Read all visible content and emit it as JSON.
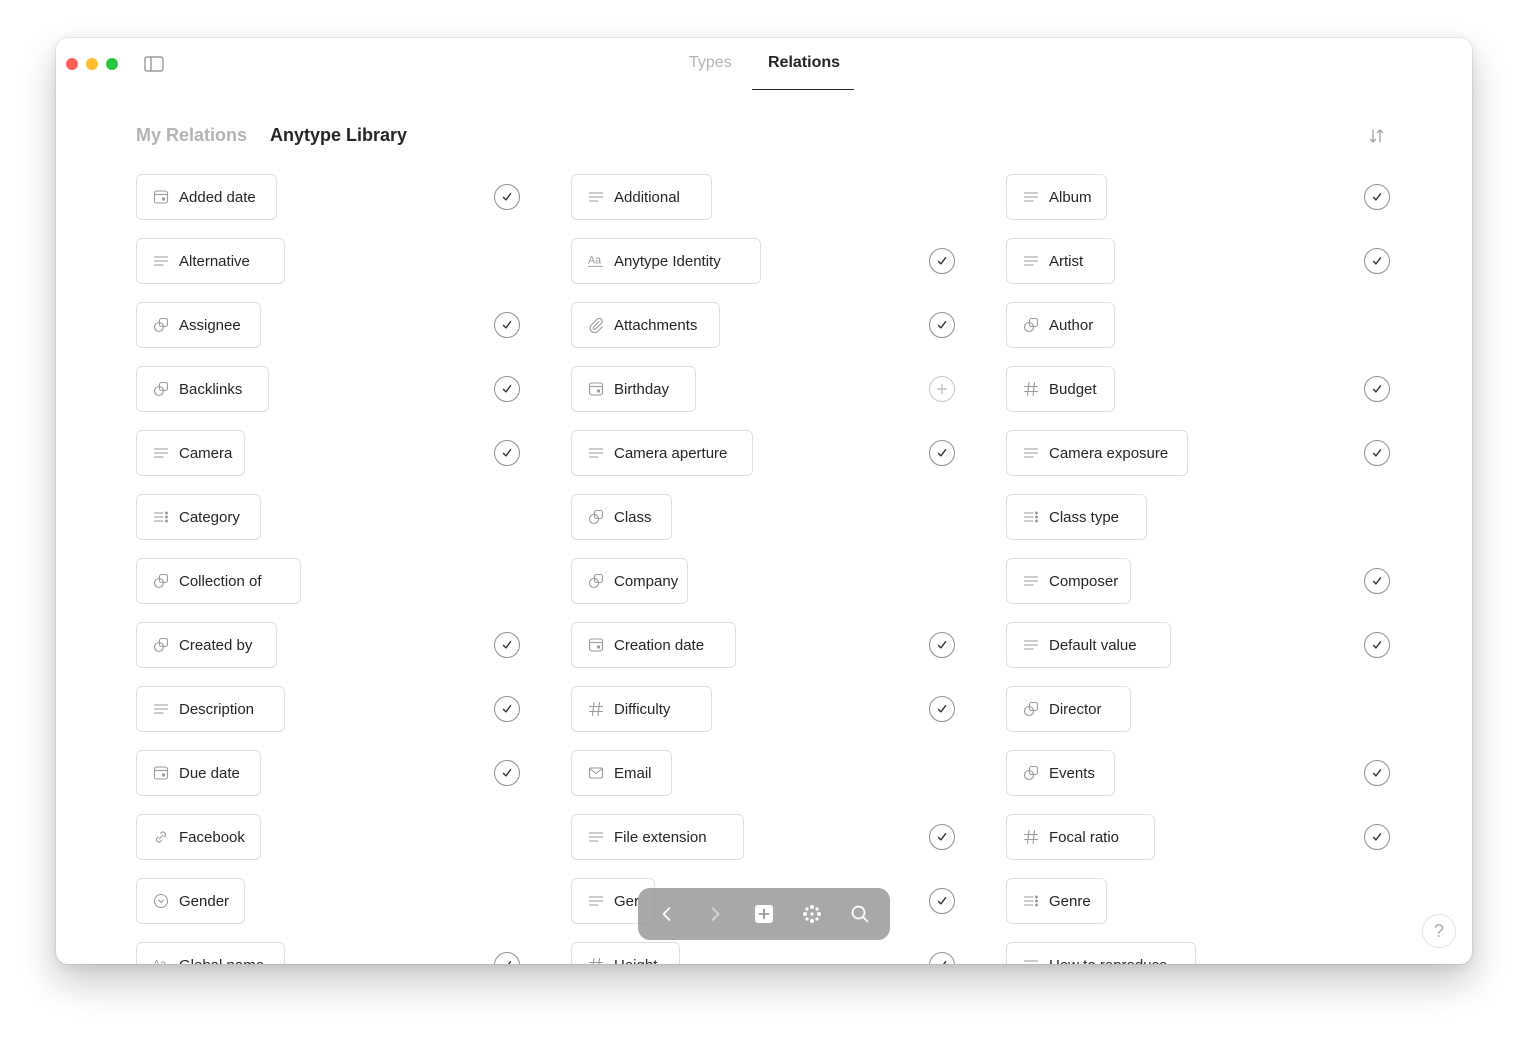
{
  "window": {
    "tabs": [
      {
        "label": "Types",
        "active": false
      },
      {
        "label": "Relations",
        "active": true
      }
    ]
  },
  "library": {
    "tabs": [
      {
        "label": "My Relations",
        "active": false
      },
      {
        "label": "Anytype Library",
        "active": true
      }
    ]
  },
  "relations": [
    {
      "label": "Added date",
      "icon": "calendar-icon",
      "status": "installed"
    },
    {
      "label": "Additional",
      "icon": "text-lines-icon",
      "status": "none"
    },
    {
      "label": "Album",
      "icon": "text-lines-icon",
      "status": "installed"
    },
    {
      "label": "Alternative",
      "icon": "text-lines-icon",
      "status": "none"
    },
    {
      "label": "Anytype Identity",
      "icon": "aa-text-icon",
      "status": "installed"
    },
    {
      "label": "Artist",
      "icon": "text-lines-icon",
      "status": "installed"
    },
    {
      "label": "Assignee",
      "icon": "object-icon",
      "status": "installed"
    },
    {
      "label": "Attachments",
      "icon": "paperclip-icon",
      "status": "installed"
    },
    {
      "label": "Author",
      "icon": "object-icon",
      "status": "none"
    },
    {
      "label": "Backlinks",
      "icon": "object-icon",
      "status": "installed"
    },
    {
      "label": "Birthday",
      "icon": "calendar-icon",
      "status": "add"
    },
    {
      "label": "Budget",
      "icon": "hash-icon",
      "status": "installed"
    },
    {
      "label": "Camera",
      "icon": "text-lines-icon",
      "status": "installed"
    },
    {
      "label": "Camera aperture",
      "icon": "text-lines-icon",
      "status": "installed"
    },
    {
      "label": "Camera exposure",
      "icon": "text-lines-icon",
      "status": "installed"
    },
    {
      "label": "Category",
      "icon": "select-list-icon",
      "status": "none"
    },
    {
      "label": "Class",
      "icon": "object-icon",
      "status": "none"
    },
    {
      "label": "Class type",
      "icon": "select-list-icon",
      "status": "none"
    },
    {
      "label": "Collection of",
      "icon": "object-icon",
      "status": "none"
    },
    {
      "label": "Company",
      "icon": "object-icon",
      "status": "none"
    },
    {
      "label": "Composer",
      "icon": "text-lines-icon",
      "status": "installed"
    },
    {
      "label": "Created by",
      "icon": "object-icon",
      "status": "installed"
    },
    {
      "label": "Creation date",
      "icon": "calendar-icon",
      "status": "installed"
    },
    {
      "label": "Default value",
      "icon": "text-lines-icon",
      "status": "installed"
    },
    {
      "label": "Description",
      "icon": "text-lines-icon",
      "status": "installed"
    },
    {
      "label": "Difficulty",
      "icon": "hash-icon",
      "status": "installed"
    },
    {
      "label": "Director",
      "icon": "object-icon",
      "status": "none"
    },
    {
      "label": "Due date",
      "icon": "calendar-icon",
      "status": "installed"
    },
    {
      "label": "Email",
      "icon": "envelope-icon",
      "status": "none"
    },
    {
      "label": "Events",
      "icon": "object-icon",
      "status": "installed"
    },
    {
      "label": "Facebook",
      "icon": "link-icon",
      "status": "none"
    },
    {
      "label": "File extension",
      "icon": "text-lines-icon",
      "status": "installed"
    },
    {
      "label": "Focal ratio",
      "icon": "hash-icon",
      "status": "installed"
    },
    {
      "label": "Gender",
      "icon": "status-circle-icon",
      "status": "none"
    },
    {
      "label": "Ger",
      "icon": "text-lines-icon",
      "status": "installed"
    },
    {
      "label": "Genre",
      "icon": "select-list-icon",
      "status": "none"
    },
    {
      "label": "Global name",
      "icon": "aa-text-icon",
      "status": "installed"
    },
    {
      "label": "Height",
      "icon": "hash-icon",
      "status": "installed"
    },
    {
      "label": "How to reproduce",
      "icon": "text-lines-icon",
      "status": "none"
    }
  ],
  "dock": {
    "buttons": [
      "back-arrow-icon",
      "forward-arrow-icon",
      "plus-square-icon",
      "graph-icon",
      "search-icon"
    ]
  },
  "help": {
    "label": "?"
  }
}
